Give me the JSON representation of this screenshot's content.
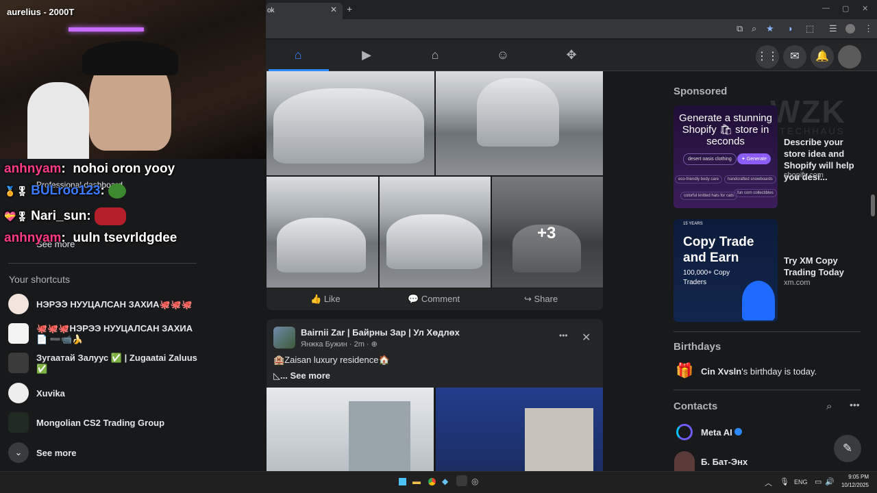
{
  "browser": {
    "tab_title": "ok",
    "tab_close": "✕",
    "new_tab": "+",
    "win_min": "—",
    "win_max": "▢",
    "win_close": "✕"
  },
  "overlay": {
    "streamer_title": "aurelius - 2000T",
    "chat": [
      {
        "user": "anhnyam",
        "msg": "nohoi oron yooy"
      },
      {
        "user": "BULroo123",
        "msg": ""
      },
      {
        "user": "Nari_sun",
        "msg": ""
      },
      {
        "user": "anhnyam",
        "msg": "uuln tsevrldgdee"
      }
    ]
  },
  "left": {
    "professional_dashboard": "Professional dashboard",
    "see_more_top": "See more",
    "shortcuts_title": "Your shortcuts",
    "shortcuts": [
      {
        "label": "НЭРЭЭ НУУЦАЛСАН ЗАХИА🐙🐙🐙"
      },
      {
        "label": "🐙🐙🐙НЭРЭЭ НУУЦАЛСАН ЗАХИА📄 ➖📹🍌"
      },
      {
        "label": "Зугаатай Залуус ✅ | Zugaatai Zaluus ✅"
      },
      {
        "label": "Xuvika"
      },
      {
        "label": "Mongolian CS2 Trading Group"
      }
    ],
    "see_more_bottom": "See more"
  },
  "post1": {
    "overlay_count": "+3",
    "like": "Like",
    "comment": "Comment",
    "share": "Share"
  },
  "post2": {
    "page_name": "Bairnii Zar | Байрны Зар | Ул Хөдлөх",
    "author": "Янжка Бужин",
    "time": "2m",
    "text": "🏨Zaisan luxury residence🏠",
    "see_more": "... See more",
    "more": "•••",
    "close": "✕"
  },
  "rail": {
    "sponsored": "Sponsored",
    "ads": [
      {
        "img_title": "Generate a stunning Shopify 🛍 store in seconds",
        "img_chip": "desert oasis clothing",
        "img_btn": "✦ Generate",
        "img_tags": [
          "eco-friendly body care",
          "handcrafted snowboards",
          "colorful knitted hats for cats",
          "fun corn collectibles"
        ],
        "text": "Describe your store idea and Shopify will help you desi...",
        "domain": "shopify.com"
      },
      {
        "img_badge": "15 YEARS",
        "img_title": "Copy Trade and Earn",
        "img_sub": "100,000+ Copy Traders",
        "text": "Try XM Copy Trading Today",
        "domain": "xm.com"
      }
    ],
    "watermark": "WZK",
    "watermark_sub": "TECHHAUS",
    "birthdays_title": "Birthdays",
    "birthday_name": "Cin Xvsln",
    "birthday_text": "'s birthday is today.",
    "contacts_title": "Contacts",
    "contacts": [
      {
        "name": "Meta AI"
      },
      {
        "name": "Б. Бат-Энх"
      }
    ]
  },
  "taskbar": {
    "lang": "ENG",
    "time": "9:05 PM",
    "date": "10/12/2025"
  },
  "colors": {
    "accent": "#2d88ff",
    "chat_user": "#ff3b8a",
    "card": "#242526"
  }
}
